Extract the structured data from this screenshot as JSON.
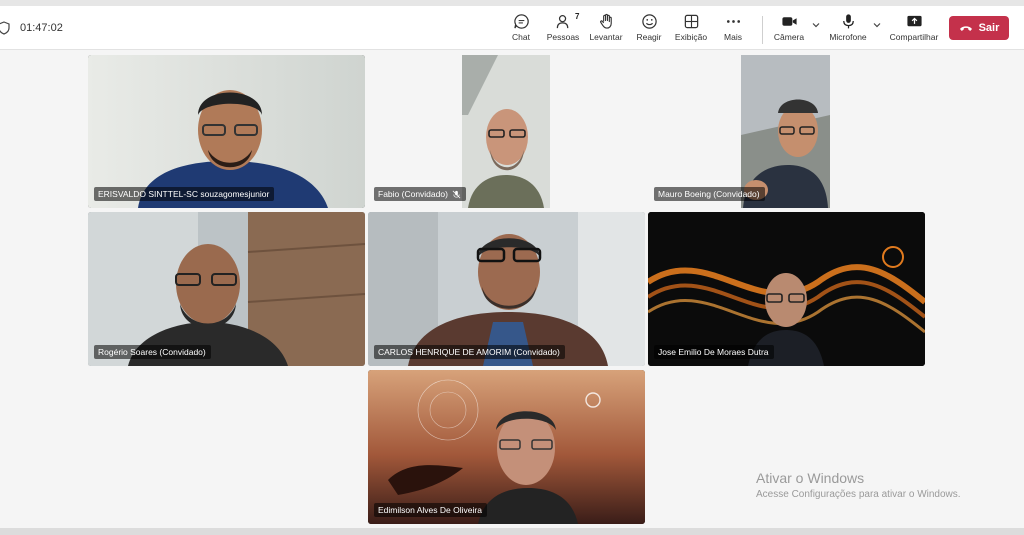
{
  "call": {
    "timer": "01:47:02"
  },
  "toolbar": {
    "chat": "Chat",
    "people": "Pessoas",
    "people_count": "7",
    "raise": "Levantar",
    "react": "Reagir",
    "view": "Exibição",
    "more": "Mais",
    "camera": "Câmera",
    "mic": "Microfone",
    "share": "Compartilhar",
    "leave": "Sair"
  },
  "participants": [
    {
      "name": "ERISVALDO SINTTEL-SC souzagomesjunior"
    },
    {
      "name": "Fabio (Convidado)"
    },
    {
      "name": "Mauro Boeing (Convidado)"
    },
    {
      "name": "Rogério Soares (Convidado)"
    },
    {
      "name": "CARLOS HENRIQUE DE AMORIM (Convidado)"
    },
    {
      "name": "Jose Emilio De Moraes Dutra"
    },
    {
      "name": "Edimilson Alves De Oliveira"
    }
  ],
  "watermark": {
    "title": "Ativar o Windows",
    "subtitle": "Acesse Configurações para ativar o Windows."
  },
  "colors": {
    "leave": "#c4314b",
    "toolbar_bg": "#ffffff",
    "stage_bg": "#f5f5f5"
  }
}
